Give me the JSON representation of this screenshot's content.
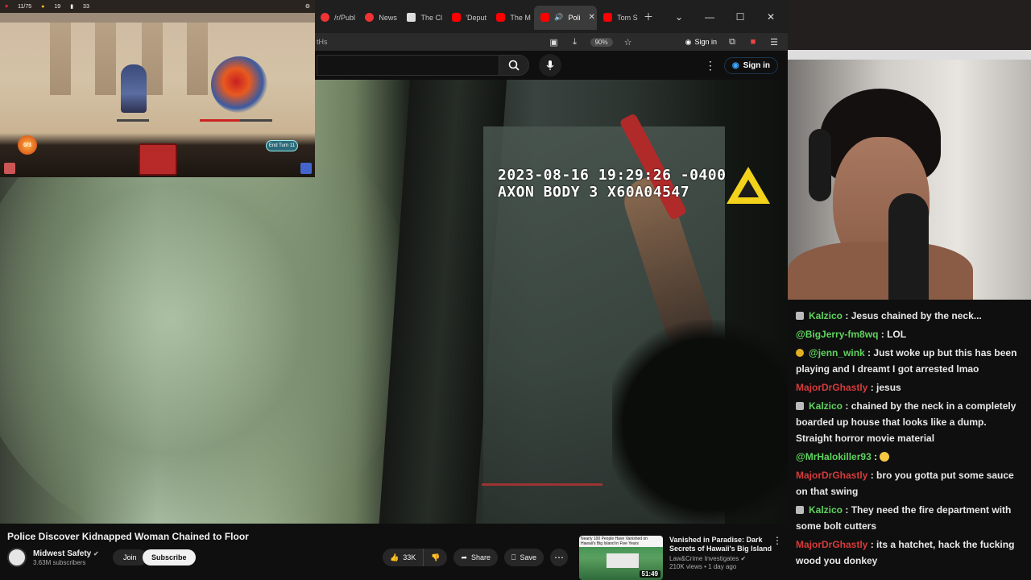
{
  "browser": {
    "tabs": [
      {
        "label": "/r/Publ",
        "icon": "reddit-icon"
      },
      {
        "label": "News",
        "icon": "reddit-icon"
      },
      {
        "label": "The Cl",
        "icon": "wikipedia-icon"
      },
      {
        "label": "'Deput",
        "icon": "youtube-icon"
      },
      {
        "label": "The M",
        "icon": "youtube-icon"
      },
      {
        "label": "Poli",
        "icon": "youtube-icon",
        "active": true
      },
      {
        "label": "Tom S",
        "icon": "youtube-icon"
      }
    ],
    "url_fragment": "tHs",
    "zoom": "90%",
    "signin_label": "Sign in"
  },
  "youtube": {
    "signin_label": "Sign in",
    "video": {
      "timestamp_line1": "2023-08-16 19:29:26 -0400",
      "timestamp_line2": "AXON BODY 3 X60A04547",
      "title": "Police Discover Kidnapped Woman Chained to Floor",
      "channel": "Midwest Safety",
      "subscribers": "3.63M subscribers",
      "join_label": "Join",
      "subscribe_label": "Subscribe",
      "likes": "33K",
      "share_label": "Share",
      "save_label": "Save"
    },
    "recommendation": {
      "title": "Vanished in Paradise: Dark Secrets of Hawaii's Big Island",
      "channel": "Law&Crime Investigates",
      "meta": "210K views • 1 day ago",
      "duration": "51:49",
      "thumb_banner": "Nearly 100 People Have Vanished on Hawaii's Big Island in Five Years"
    }
  },
  "game": {
    "hp": "11/75",
    "gold": "19",
    "floor": "33",
    "energy": "0/3",
    "end_turn_label": "End Turn",
    "end_turn_count": "11"
  },
  "chat": [
    {
      "user": "Kalzico",
      "color": "#5fd35f",
      "badge": "sub",
      "text": "Jesus chained by the neck..."
    },
    {
      "user": "@BigJerry-fm8wq",
      "color": "#5fd35f",
      "badge": "",
      "text": "LOL"
    },
    {
      "user": "@jenn_wink",
      "color": "#5fd35f",
      "badge": "gold",
      "text": "Just woke up but this has been playing and I dreamt I got arrested lmao"
    },
    {
      "user": "MajorDrGhastly",
      "color": "#d63b3b",
      "badge": "",
      "text": "jesus"
    },
    {
      "user": "Kalzico",
      "color": "#5fd35f",
      "badge": "sub",
      "text": "chained by the neck in a completely boarded up house that looks like a dump. Straight horror movie material"
    },
    {
      "user": "@MrHalokiller93",
      "color": "#5fd35f",
      "badge": "",
      "text": "",
      "emote": true
    },
    {
      "user": "MajorDrGhastly",
      "color": "#d63b3b",
      "badge": "",
      "text": "bro you gotta put some sauce on that swing"
    },
    {
      "user": "Kalzico",
      "color": "#5fd35f",
      "badge": "sub",
      "text": "They need the fire department with some bolt cutters"
    },
    {
      "user": "MajorDrGhastly",
      "color": "#d63b3b",
      "badge": "",
      "text": "its a hatchet, hack the fucking wood you donkey"
    }
  ]
}
